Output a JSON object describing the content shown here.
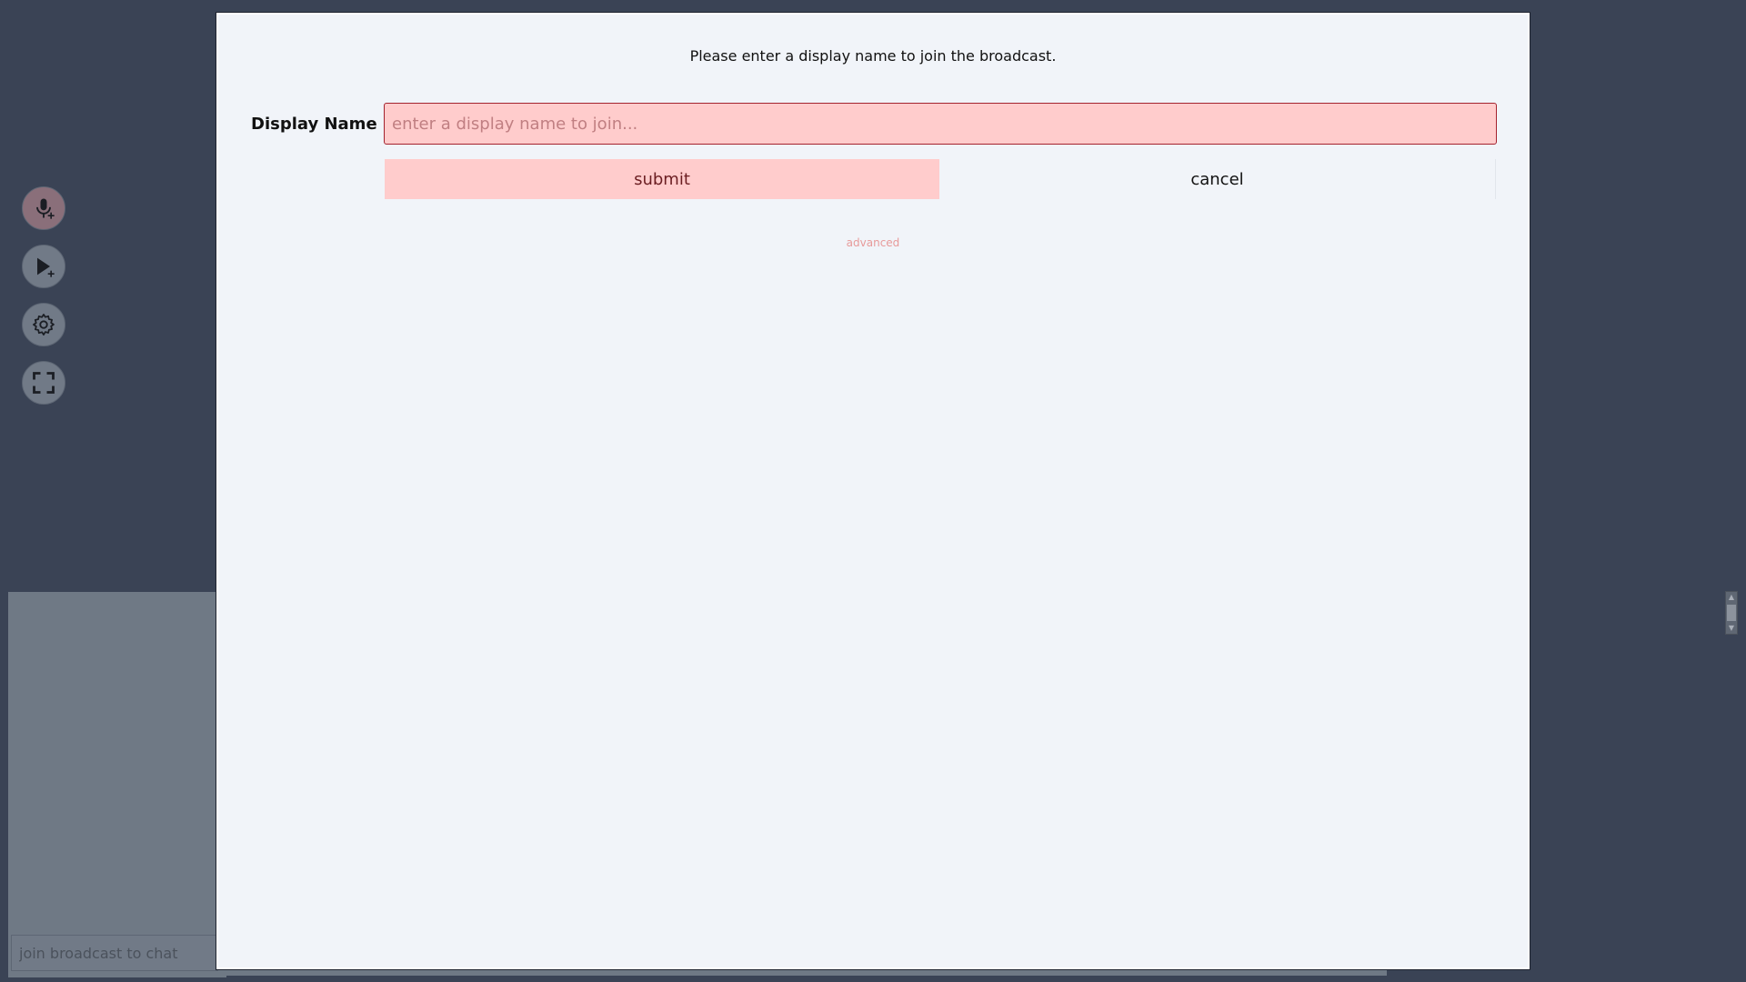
{
  "side_buttons": {
    "add_mic_icon": "microphone-plus-icon",
    "add_video_icon": "play-plus-icon",
    "settings_icon": "gear-icon",
    "fullscreen_icon": "fullscreen-icon"
  },
  "chat": {
    "placeholder": "join broadcast to chat"
  },
  "modal": {
    "message": "Please enter a display name to join the broadcast.",
    "display_name_label": "Display Name",
    "display_name_placeholder": "enter a display name to join...",
    "display_name_value": "",
    "submit_label": "submit",
    "cancel_label": "cancel",
    "advanced_label": "advanced"
  },
  "colors": {
    "page_bg": "#3a4355",
    "modal_bg": "#f1f4f9",
    "input_bg": "#ffcccc",
    "input_border": "#a4222e",
    "advanced_link": "#e79a9a"
  }
}
